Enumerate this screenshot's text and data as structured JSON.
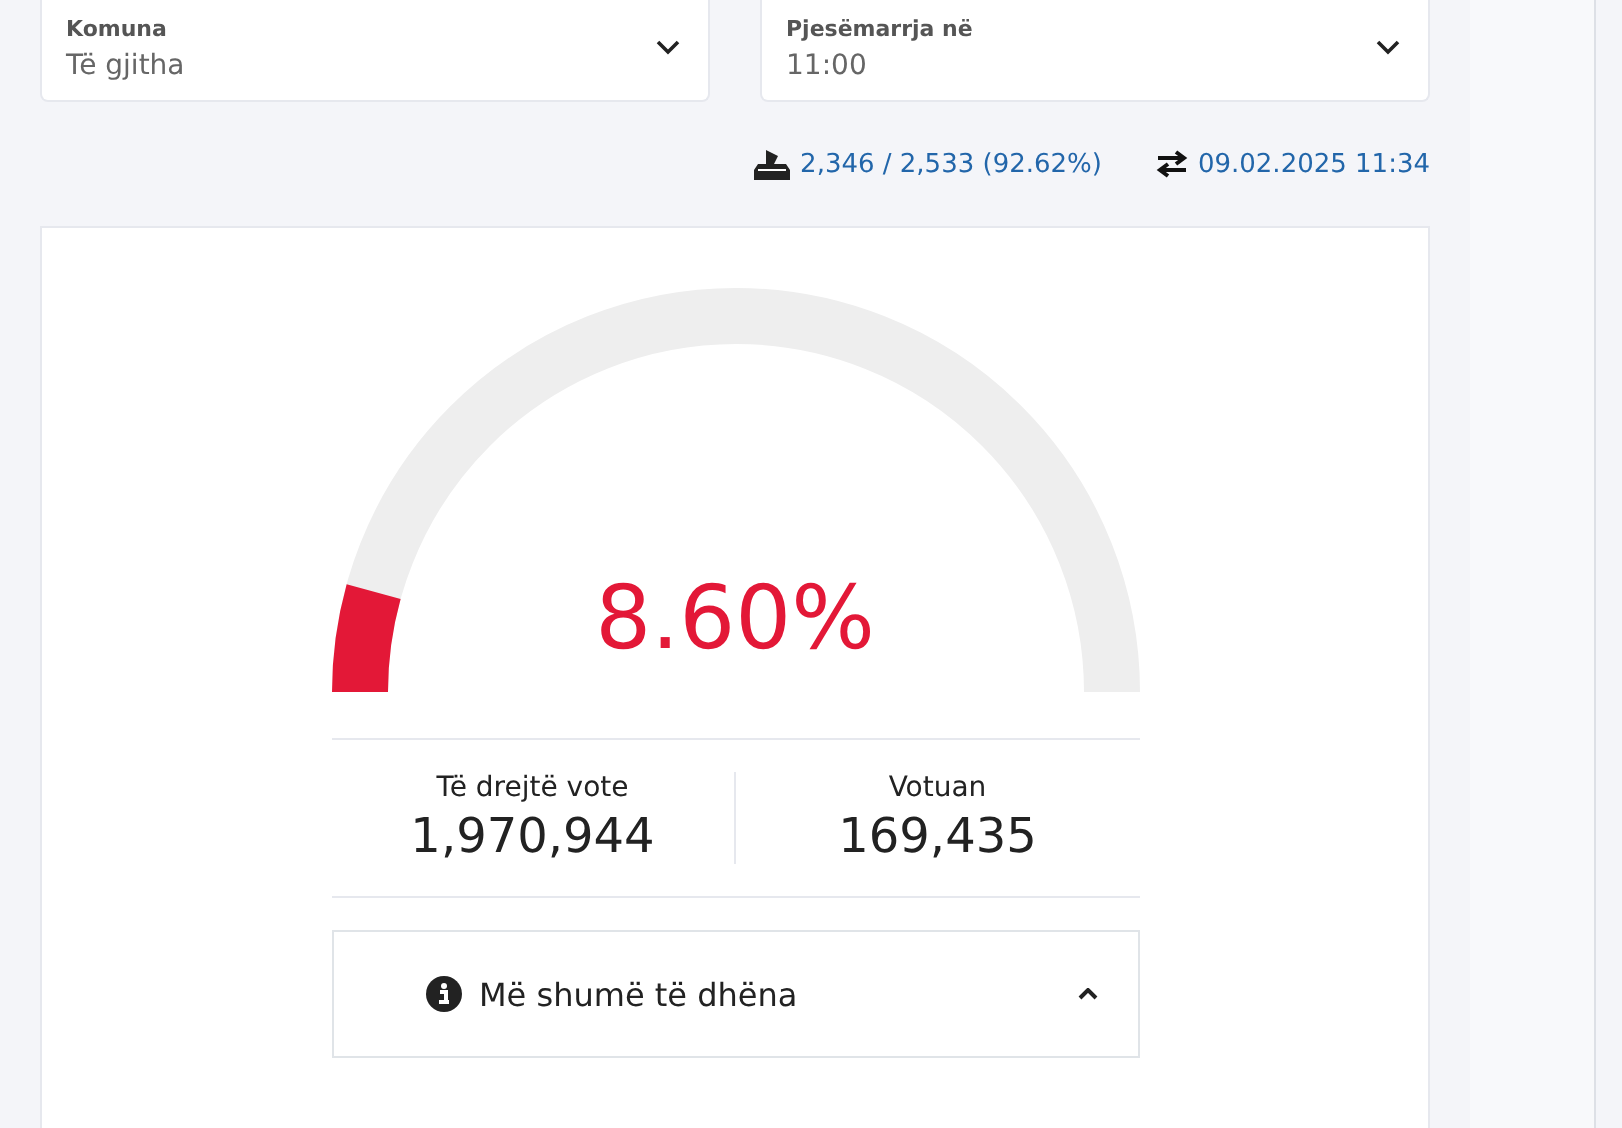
{
  "filters": [
    {
      "label": "Komuna",
      "value": "Të gjitha"
    },
    {
      "label": "Pjesëmarrja në",
      "value": "11:00"
    }
  ],
  "stations": "2,346 / 2,533 (92.62%)",
  "updated": "09.02.2025 11:34",
  "gauge": {
    "level": 0.086,
    "reading": "8.60%"
  },
  "stats": [
    {
      "label": "Të drejtë vote",
      "value": "1,970,944"
    },
    {
      "label": "Votuan",
      "value": "169,435"
    }
  ],
  "more": {
    "label": "Më shumë të dhëna",
    "expanded": true
  }
}
